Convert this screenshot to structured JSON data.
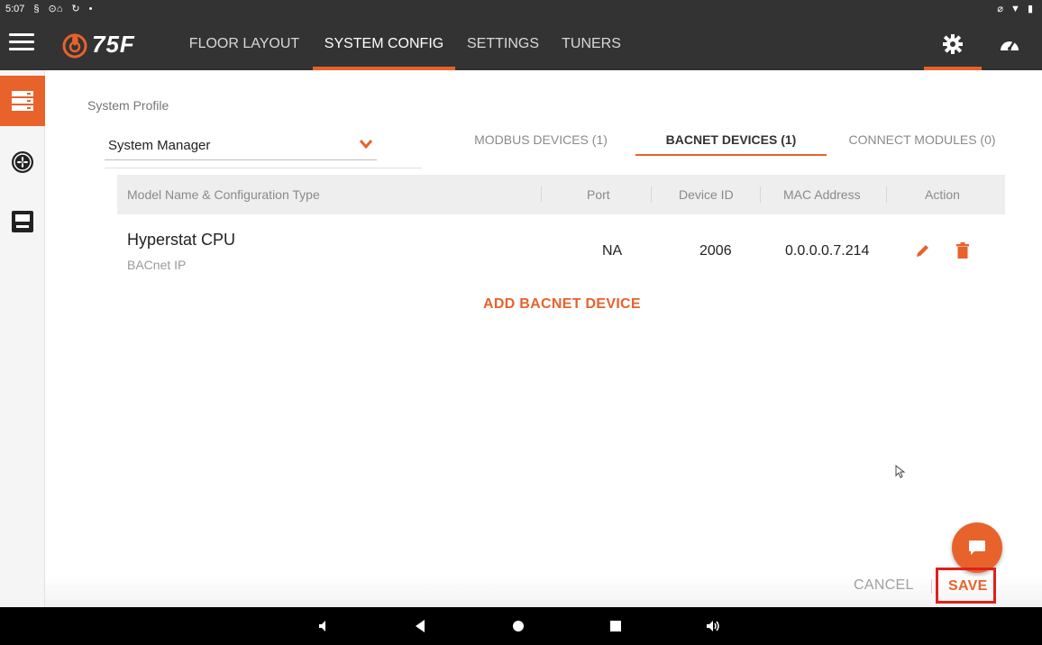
{
  "status_bar": {
    "time": "5:07"
  },
  "app_bar": {
    "logo_text": "75F",
    "tabs": [
      {
        "label": "FLOOR LAYOUT",
        "active": false
      },
      {
        "label": "SYSTEM CONFIG",
        "active": true
      },
      {
        "label": "SETTINGS",
        "active": false
      },
      {
        "label": "TUNERS",
        "active": false
      }
    ]
  },
  "side_rail": {
    "items": [
      {
        "icon": "server-stack-icon",
        "active": true
      },
      {
        "icon": "fan-icon",
        "active": false
      },
      {
        "icon": "thermostat-icon",
        "active": false
      }
    ]
  },
  "profile": {
    "label": "System Profile",
    "selected": "System Manager"
  },
  "sub_tabs": [
    {
      "label": "MODBUS DEVICES (1)",
      "active": false
    },
    {
      "label": "BACNET DEVICES (1)",
      "active": true
    },
    {
      "label": "CONNECT MODULES (0)",
      "active": false
    }
  ],
  "table": {
    "columns": [
      "Model Name & Configuration Type",
      "Port",
      "Device ID",
      "MAC Address",
      "Action"
    ],
    "rows": [
      {
        "name": "Hyperstat CPU",
        "type": "BACnet IP",
        "port": "NA",
        "device_id": "2006",
        "mac": "0.0.0.0.7.214"
      }
    ]
  },
  "add_device_label": "ADD BACNET DEVICE",
  "footer": {
    "cancel_label": "CANCEL",
    "save_label": "SAVE"
  },
  "colors": {
    "accent": "#e8622c",
    "app_bar": "#333333",
    "highlight_box": "#e0201b"
  }
}
